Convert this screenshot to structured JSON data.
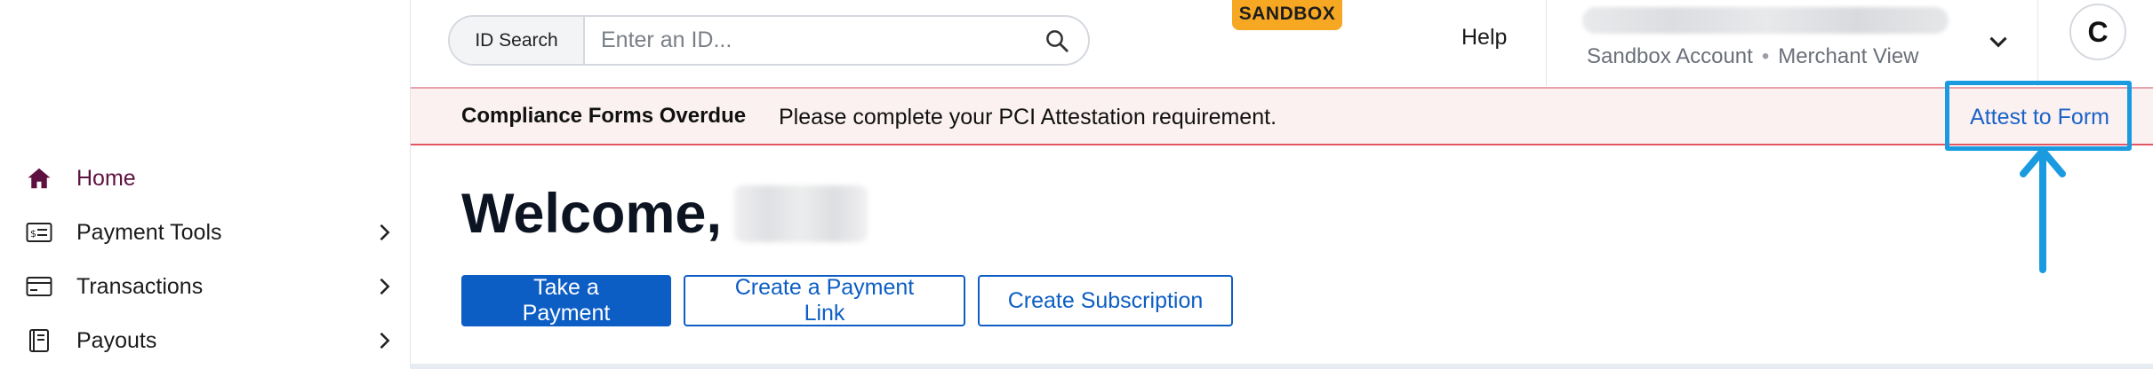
{
  "sidebar": {
    "items": [
      {
        "label": "Home",
        "icon": "home-icon",
        "active": true
      },
      {
        "label": "Payment Tools",
        "icon": "payment-card-icon",
        "has_children": true
      },
      {
        "label": "Transactions",
        "icon": "credit-card-icon",
        "has_children": true
      },
      {
        "label": "Payouts",
        "icon": "ledger-icon",
        "has_children": true
      }
    ]
  },
  "header": {
    "search": {
      "type_label": "ID Search",
      "placeholder": "Enter an ID...",
      "value": ""
    },
    "environment_badge": "SANDBOX",
    "help_label": "Help",
    "account": {
      "type": "Sandbox Account",
      "separator": "•",
      "view": "Merchant View"
    },
    "avatar_initial": "C"
  },
  "banner": {
    "title": "Compliance Forms Overdue",
    "message": "Please complete your PCI Attestation requirement.",
    "action_label": "Attest to Form"
  },
  "main": {
    "welcome_prefix": "Welcome,",
    "actions": {
      "take_payment": "Take a Payment",
      "create_link": "Create a Payment Link",
      "create_subscription": "Create Subscription"
    }
  },
  "colors": {
    "brand_blue": "#0d5ec4",
    "link_blue": "#1a63c7",
    "active_nav": "#5e1140",
    "sandbox_badge": "#f7a823",
    "banner_border": "#e25563",
    "annotation": "#1a9be0"
  }
}
